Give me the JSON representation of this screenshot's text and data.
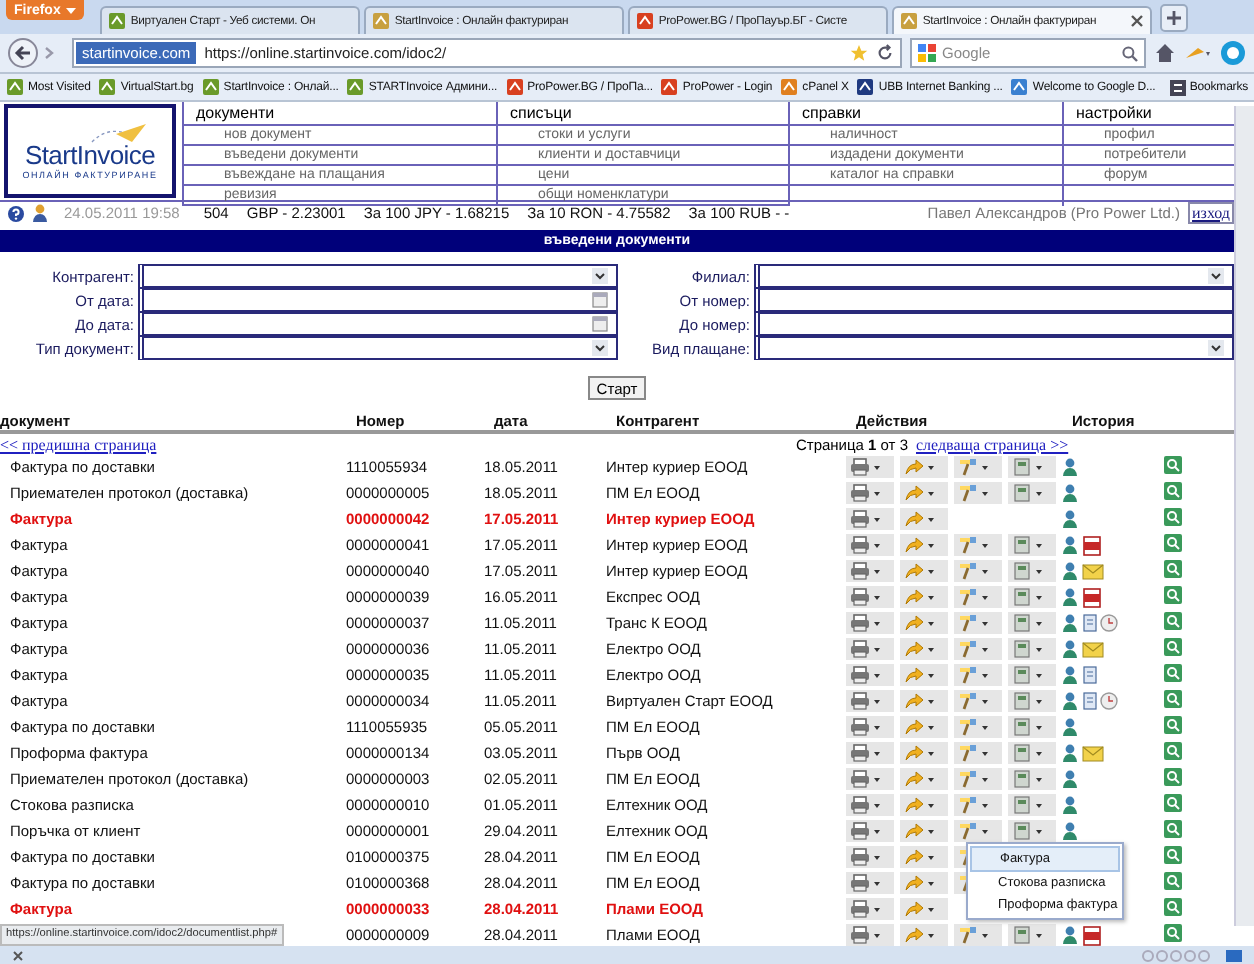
{
  "browser": {
    "menu_button": "Firefox",
    "tabs": [
      {
        "title": "Виртуален Старт - Уеб системи. Он",
        "selected": false
      },
      {
        "title": "StartInvoice : Онлайн фактуриран",
        "selected": false
      },
      {
        "title": "ProPower.BG / ПроПауър.БГ - Систе",
        "selected": false
      },
      {
        "title": "StartInvoice : Онлайн фактуриран",
        "selected": true
      }
    ],
    "identity": "startinvoice.com",
    "url": "https://online.startinvoice.com/idoc2/",
    "search_placeholder": "Google",
    "bookmarks": [
      "Most Visited",
      "VirtualStart.bg",
      "StartInvoice : Онлай...",
      "STARTInvoice Админи...",
      "ProPower.BG / ПроПа...",
      "ProPower - Login",
      "cPanel X",
      "UBB Internet Banking ...",
      "Welcome to Google D..."
    ],
    "bookmarks_menu": "Bookmarks"
  },
  "header": {
    "logo": {
      "name": "StartInvoice",
      "tagline": "ОНЛАЙН ФАКТУРИРАНЕ"
    },
    "menus": [
      {
        "title": "документи",
        "items": [
          "нов документ",
          "въведени документи",
          "въвеждане на плащания",
          "ревизия"
        ]
      },
      {
        "title": "списъци",
        "items": [
          "стоки и услуги",
          "клиенти и доставчици",
          "цени",
          "общи номенклатури"
        ]
      },
      {
        "title": "справки",
        "items": [
          "наличност",
          "издадени документи",
          "каталог на справки"
        ]
      },
      {
        "title": "настройки",
        "items": [
          "профил",
          "потребители",
          "форум"
        ]
      }
    ]
  },
  "info": {
    "datetime": "24.05.2011 19:58",
    "rates": [
      "504",
      "GBP - 2.23001",
      "За 100 JPY - 1.68215",
      "За 10 RON - 4.75582",
      "За 100 RUB - -"
    ],
    "user": "Павел Александров (Pro Power Ltd.)",
    "logout": "изход"
  },
  "page_title": "въведени документи",
  "filters": {
    "left": [
      {
        "label": "Контрагент:",
        "kind": "select"
      },
      {
        "label": "От дата:",
        "kind": "date"
      },
      {
        "label": "До дата:",
        "kind": "date"
      },
      {
        "label": "Тип документ:",
        "kind": "select"
      }
    ],
    "right": [
      {
        "label": "Филиал:",
        "kind": "select"
      },
      {
        "label": "От номер:",
        "kind": "text"
      },
      {
        "label": "До номер:",
        "kind": "text"
      },
      {
        "label": "Вид плащане:",
        "kind": "select"
      }
    ]
  },
  "start_button": "Старт",
  "table": {
    "columns": [
      "документ",
      "Номер",
      "дата",
      "Контрагент",
      "Действия",
      "История"
    ],
    "prev_page": "<< предишна страница",
    "page_info": "Страница **1** от 3",
    "next_page": "следваща страница >>",
    "rows": [
      {
        "document": "Фактура по доставки",
        "number": "1110055934",
        "date": "18.05.2011",
        "contractor": "Интер куриер ЕООД",
        "highlighted": false,
        "actions": [
          {
            "kind": "print"
          },
          {
            "kind": "forward"
          },
          {
            "kind": "edit"
          },
          {
            "kind": "copy"
          }
        ],
        "history": [
          {
            "kind": "person"
          }
        ]
      },
      {
        "document": "Приемателен протокол (доставка)",
        "number": "0000000005",
        "date": "18.05.2011",
        "contractor": "ПМ Ел ЕООД",
        "highlighted": false,
        "actions": [
          {
            "kind": "print"
          },
          {
            "kind": "forward"
          },
          {
            "kind": "edit"
          },
          {
            "kind": "copy"
          }
        ],
        "history": [
          {
            "kind": "person"
          }
        ]
      },
      {
        "document": "Фактура",
        "number": "0000000042",
        "date": "17.05.2011",
        "contractor": "Интер куриер ЕООД",
        "highlighted": true,
        "actions": [
          {
            "kind": "print"
          },
          {
            "kind": "forward"
          }
        ],
        "history": [
          {
            "kind": "person"
          }
        ]
      },
      {
        "document": "Фактура",
        "number": "0000000041",
        "date": "17.05.2011",
        "contractor": "Интер куриер ЕООД",
        "highlighted": false,
        "actions": [
          {
            "kind": "print"
          },
          {
            "kind": "forward"
          },
          {
            "kind": "edit"
          },
          {
            "kind": "copy"
          }
        ],
        "history": [
          {
            "kind": "person"
          },
          {
            "kind": "pdf"
          }
        ]
      },
      {
        "document": "Фактура",
        "number": "0000000040",
        "date": "17.05.2011",
        "contractor": "Интер куриер ЕООД",
        "highlighted": false,
        "actions": [
          {
            "kind": "print"
          },
          {
            "kind": "forward"
          },
          {
            "kind": "edit"
          },
          {
            "kind": "copy"
          }
        ],
        "history": [
          {
            "kind": "person"
          },
          {
            "kind": "envelope"
          }
        ]
      },
      {
        "document": "Фактура",
        "number": "0000000039",
        "date": "16.05.2011",
        "contractor": "Експрес ООД",
        "highlighted": false,
        "actions": [
          {
            "kind": "print"
          },
          {
            "kind": "forward"
          },
          {
            "kind": "edit"
          },
          {
            "kind": "copy"
          }
        ],
        "history": [
          {
            "kind": "person"
          },
          {
            "kind": "pdf"
          }
        ]
      },
      {
        "document": "Фактура",
        "number": "0000000037",
        "date": "11.05.2011",
        "contractor": "Транс К ЕООД",
        "highlighted": false,
        "actions": [
          {
            "kind": "print"
          },
          {
            "kind": "forward"
          },
          {
            "kind": "edit"
          },
          {
            "kind": "copy"
          }
        ],
        "history": [
          {
            "kind": "person"
          },
          {
            "kind": "note"
          },
          {
            "kind": "clock"
          }
        ]
      },
      {
        "document": "Фактура",
        "number": "0000000036",
        "date": "11.05.2011",
        "contractor": "Електро ООД",
        "highlighted": false,
        "actions": [
          {
            "kind": "print"
          },
          {
            "kind": "forward"
          },
          {
            "kind": "edit"
          },
          {
            "kind": "copy"
          }
        ],
        "history": [
          {
            "kind": "person"
          },
          {
            "kind": "envelope"
          }
        ]
      },
      {
        "document": "Фактура",
        "number": "0000000035",
        "date": "11.05.2011",
        "contractor": "Електро ООД",
        "highlighted": false,
        "actions": [
          {
            "kind": "print"
          },
          {
            "kind": "forward"
          },
          {
            "kind": "edit"
          },
          {
            "kind": "copy"
          }
        ],
        "history": [
          {
            "kind": "person"
          },
          {
            "kind": "note"
          }
        ]
      },
      {
        "document": "Фактура",
        "number": "0000000034",
        "date": "11.05.2011",
        "contractor": "Виртуален Старт ЕООД",
        "highlighted": false,
        "actions": [
          {
            "kind": "print"
          },
          {
            "kind": "forward"
          },
          {
            "kind": "edit"
          },
          {
            "kind": "copy"
          }
        ],
        "history": [
          {
            "kind": "person"
          },
          {
            "kind": "note"
          },
          {
            "kind": "clock"
          }
        ]
      },
      {
        "document": "Фактура по доставки",
        "number": "1110055935",
        "date": "05.05.2011",
        "contractor": "ПМ Ел ЕООД",
        "highlighted": false,
        "actions": [
          {
            "kind": "print"
          },
          {
            "kind": "forward"
          },
          {
            "kind": "edit"
          },
          {
            "kind": "copy"
          }
        ],
        "history": [
          {
            "kind": "person"
          }
        ]
      },
      {
        "document": "Проформа фактура",
        "number": "0000000134",
        "date": "03.05.2011",
        "contractor": "Първ ООД",
        "highlighted": false,
        "actions": [
          {
            "kind": "print"
          },
          {
            "kind": "forward"
          },
          {
            "kind": "edit"
          },
          {
            "kind": "copy"
          }
        ],
        "history": [
          {
            "kind": "person"
          },
          {
            "kind": "envelope"
          }
        ]
      },
      {
        "document": "Приемателен протокол (доставка)",
        "number": "0000000003",
        "date": "02.05.2011",
        "contractor": "ПМ Ел ЕООД",
        "highlighted": false,
        "actions": [
          {
            "kind": "print"
          },
          {
            "kind": "forward"
          },
          {
            "kind": "edit"
          },
          {
            "kind": "copy"
          }
        ],
        "history": [
          {
            "kind": "person"
          }
        ]
      },
      {
        "document": "Стокова разписка",
        "number": "0000000010",
        "date": "01.05.2011",
        "contractor": "Елтехник ООД",
        "highlighted": false,
        "actions": [
          {
            "kind": "print"
          },
          {
            "kind": "forward"
          },
          {
            "kind": "edit"
          },
          {
            "kind": "copy"
          }
        ],
        "history": [
          {
            "kind": "person"
          }
        ]
      },
      {
        "document": "Поръчка от клиент",
        "number": "0000000001",
        "date": "29.04.2011",
        "contractor": "Елтехник ООД",
        "highlighted": false,
        "actions": [
          {
            "kind": "print"
          },
          {
            "kind": "forward"
          },
          {
            "kind": "edit"
          },
          {
            "kind": "copy"
          }
        ],
        "history": [
          {
            "kind": "person"
          }
        ],
        "menu": [
          {
            "label": "Фактура",
            "selected": true
          },
          {
            "label": "Стокова разписка",
            "selected": false
          },
          {
            "label": "Проформа фактура",
            "selected": false
          }
        ]
      },
      {
        "document": "Фактура по доставки",
        "number": "0100000375",
        "date": "28.04.2011",
        "contractor": "ПМ Ел ЕООД",
        "highlighted": false,
        "actions": [
          {
            "kind": "print"
          },
          {
            "kind": "forward"
          },
          {
            "kind": "edit"
          }
        ]
      },
      {
        "document": "Фактура по доставки",
        "number": "0100000368",
        "date": "28.04.2011",
        "contractor": "ПМ Ел ЕООД",
        "highlighted": false,
        "actions": [
          {
            "kind": "print"
          },
          {
            "kind": "forward"
          },
          {
            "kind": "edit"
          }
        ]
      },
      {
        "document": "Фактура",
        "number": "0000000033",
        "date": "28.04.2011",
        "contractor": "Плами ЕООД",
        "highlighted": true,
        "actions": [
          {
            "kind": "print"
          },
          {
            "kind": "forward"
          }
        ]
      },
      {
        "number": "0000000009",
        "date": "28.04.2011",
        "contractor": "Плами ЕООД",
        "highlighted": false,
        "actions": [
          {
            "kind": "print"
          },
          {
            "kind": "forward"
          },
          {
            "kind": "edit"
          },
          {
            "kind": "copy"
          }
        ],
        "history": [
          {
            "kind": "person"
          },
          {
            "kind": "pdf"
          }
        ]
      }
    ]
  },
  "status_url": "https://online.startinvoice.com/idoc2/documentlist.php#"
}
